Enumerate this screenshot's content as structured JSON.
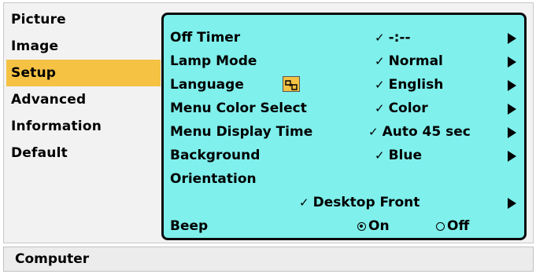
{
  "sidebar": {
    "items": [
      {
        "label": "Picture"
      },
      {
        "label": "Image"
      },
      {
        "label": "Setup"
      },
      {
        "label": "Advanced"
      },
      {
        "label": "Information"
      },
      {
        "label": "Default"
      }
    ],
    "selected": "Setup"
  },
  "panel": {
    "rows": [
      {
        "label": "Off Timer",
        "value": "-:--"
      },
      {
        "label": "Lamp Mode",
        "value": "Normal"
      },
      {
        "label": "Language",
        "value": "English"
      },
      {
        "label": "Menu Color Select",
        "value": "Color"
      },
      {
        "label": "Menu Display Time",
        "value": "Auto 45 sec"
      },
      {
        "label": "Background",
        "value": "Blue"
      },
      {
        "label": "Orientation",
        "value": "Desktop Front"
      }
    ],
    "beep": {
      "label": "Beep",
      "on_label": "On",
      "off_label": "Off",
      "selected": "On"
    },
    "check_glyph": "✓"
  },
  "status": {
    "text": "Computer"
  },
  "colors": {
    "panel_bg": "#7ff0ec",
    "highlight": "#f5c244"
  }
}
